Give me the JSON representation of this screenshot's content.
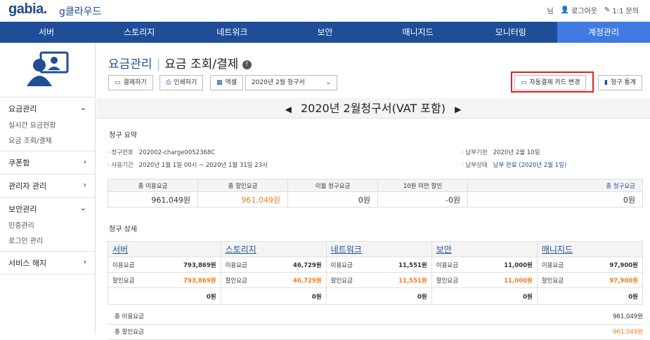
{
  "brand": {
    "logo": "gabia.",
    "product": "g클라우드"
  },
  "top_links": {
    "user": "님",
    "logout": "로그아웃",
    "inquiry": "1:1 문의"
  },
  "nav": [
    "서버",
    "스토리지",
    "네트워크",
    "보안",
    "매니지드",
    "모니터링",
    "계정관리"
  ],
  "sidebar": [
    {
      "label": "요금관리",
      "chev": "⌄",
      "subs": [
        "실시간 요금현황",
        "요금 조회/결제"
      ]
    },
    {
      "label": "쿠폰함",
      "chev": "›",
      "subs": []
    },
    {
      "label": "관리자 관리",
      "chev": "›",
      "subs": []
    },
    {
      "label": "보안관리",
      "chev": "⌄",
      "subs": [
        "인증관리",
        "로그인 관리"
      ]
    },
    {
      "label": "서비스 해지",
      "chev": "›",
      "subs": []
    }
  ],
  "page": {
    "title_a": "요금관리",
    "title_b": "요금 조회/결제"
  },
  "toolbar": {
    "pay": "결제하기",
    "print": "인쇄하기",
    "excel": "엑셀",
    "month_select": "2020년 2월 청구서",
    "card_change": "자동결제 카드 변경",
    "stats": "청구 통계"
  },
  "invoice_title": "2020년 2월청구서(VAT 포함)",
  "summary": {
    "heading": "청구 요약",
    "bill_no_k": "청구번호",
    "bill_no": "202002-charge0052368C",
    "period_k": "사용기간",
    "period": "2020년 1월 1일 00시 ~ 2020년 1월 31일 23시",
    "due_k": "납부기한",
    "due": "2020년 2월 10일",
    "status_k": "납부상태",
    "status": "납부 완료 (2020년 2월 1일)",
    "cols": [
      "총 이용요금",
      "총 할인요금",
      "이월 청구요금",
      "10원 미만 할인",
      "총 청구요금"
    ],
    "vals": [
      "961,049원",
      "961,049원",
      "0원",
      "-0원",
      "0원"
    ]
  },
  "detail": {
    "heading": "청구 상세",
    "cats": [
      {
        "name": "서버",
        "use": "793,869원",
        "disc": "793,869원",
        "total": "0원"
      },
      {
        "name": "스토리지",
        "use": "46,729원",
        "disc": "46,729원",
        "total": "0원"
      },
      {
        "name": "네트워크",
        "use": "11,551원",
        "disc": "11,551원",
        "total": "0원"
      },
      {
        "name": "보안",
        "use": "11,000원",
        "disc": "11,000원",
        "total": "0원"
      },
      {
        "name": "매니지드",
        "use": "97,900원",
        "disc": "97,900원",
        "total": "0원"
      }
    ],
    "use_label": "이용요금",
    "disc_label": "할인요금",
    "grand_use_label": "총 이용요금",
    "grand_use": "961,049원",
    "grand_disc_label": "총 할인요금",
    "grand_disc": "961,049원"
  },
  "colors": {
    "nav": "#1f4e98",
    "active": "#3f7be0",
    "orange": "#f07d1f",
    "highlight": "#e02020"
  }
}
